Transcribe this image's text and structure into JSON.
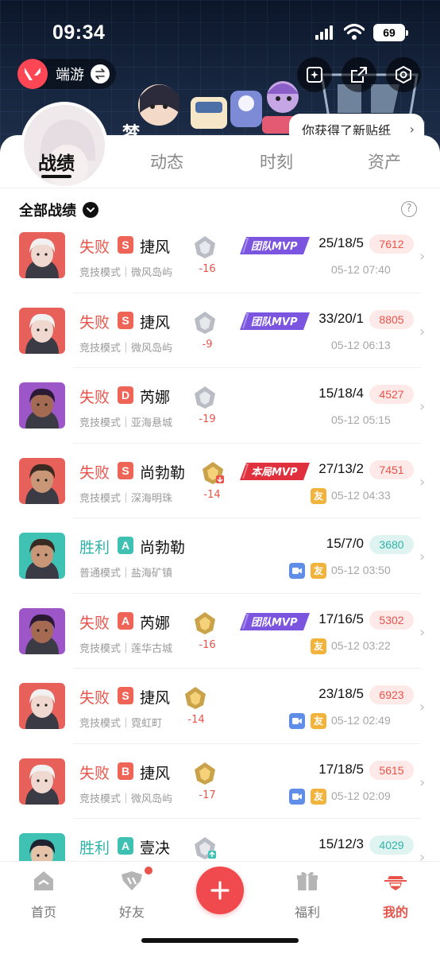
{
  "status_bar": {
    "time": "09:34",
    "battery": "69"
  },
  "header": {
    "app_name": "端游",
    "nickname_fragment": "梦",
    "sticker_tip": "你获得了新贴纸"
  },
  "tabs": [
    "战绩",
    "动态",
    "时刻",
    "资产"
  ],
  "filter": {
    "label": "全部战绩"
  },
  "matches": [
    {
      "result": "失败",
      "outcome": "lose",
      "grade": "S",
      "agent": "捷风",
      "mode": "竞技模式｜微风岛屿",
      "rr": "-16",
      "mvp": "团队MVP",
      "kda": "25/18/5",
      "score": "7612",
      "time": "05-12 07:40"
    },
    {
      "result": "失败",
      "outcome": "lose",
      "grade": "S",
      "agent": "捷风",
      "mode": "竞技模式｜微风岛屿",
      "rr": "-9",
      "mvp": "团队MVP",
      "kda": "33/20/1",
      "score": "8805",
      "time": "05-12 06:13"
    },
    {
      "result": "失败",
      "outcome": "lose",
      "grade": "D",
      "agent": "芮娜",
      "mode": "竞技模式｜亚海悬城",
      "rr": "-19",
      "mvp": "",
      "kda": "15/18/4",
      "score": "4527",
      "time": "05-12 05:15"
    },
    {
      "result": "失败",
      "outcome": "lose",
      "grade": "S",
      "agent": "尚勃勒",
      "mode": "竞技模式｜深海明珠",
      "rr": "-14",
      "mvp": "本局MVP",
      "kda": "27/13/2",
      "score": "7451",
      "time": "05-12 04:33",
      "friend": "友"
    },
    {
      "result": "胜利",
      "outcome": "win",
      "grade": "A",
      "agent": "尚勃勒",
      "mode": "普通模式｜盐海矿镇",
      "rr": "",
      "mvp": "",
      "kda": "15/7/0",
      "score": "3680",
      "time": "05-12 03:50",
      "friend": "友",
      "video": true
    },
    {
      "result": "失败",
      "outcome": "lose",
      "grade": "A",
      "agent": "芮娜",
      "mode": "竞技模式｜莲华古城",
      "rr": "-16",
      "mvp": "团队MVP",
      "kda": "17/16/5",
      "score": "5302",
      "time": "05-12 03:22",
      "friend": "友"
    },
    {
      "result": "失败",
      "outcome": "lose",
      "grade": "S",
      "agent": "捷风",
      "mode": "竞技模式｜霓虹町",
      "rr": "-14",
      "mvp": "",
      "kda": "23/18/5",
      "score": "6923",
      "time": "05-12 02:49",
      "friend": "友",
      "video": true
    },
    {
      "result": "失败",
      "outcome": "lose",
      "grade": "B",
      "agent": "捷风",
      "mode": "竞技模式｜微风岛屿",
      "rr": "-17",
      "mvp": "",
      "kda": "17/18/5",
      "score": "5615",
      "time": "05-12 02:09",
      "friend": "友",
      "video": true
    },
    {
      "result": "胜利",
      "outcome": "win",
      "grade": "A",
      "agent": "壹决",
      "mode": "",
      "rr": "",
      "mvp": "",
      "kda": "15/12/3",
      "score": "4029",
      "time": ""
    }
  ],
  "bottom_nav": [
    "首页",
    "好友",
    "福利",
    "我的"
  ],
  "colors": {
    "accent": "#e8534a",
    "win": "#2fb3a8",
    "mvp_team": "#7b55e0",
    "mvp_match": "#e0303d"
  }
}
